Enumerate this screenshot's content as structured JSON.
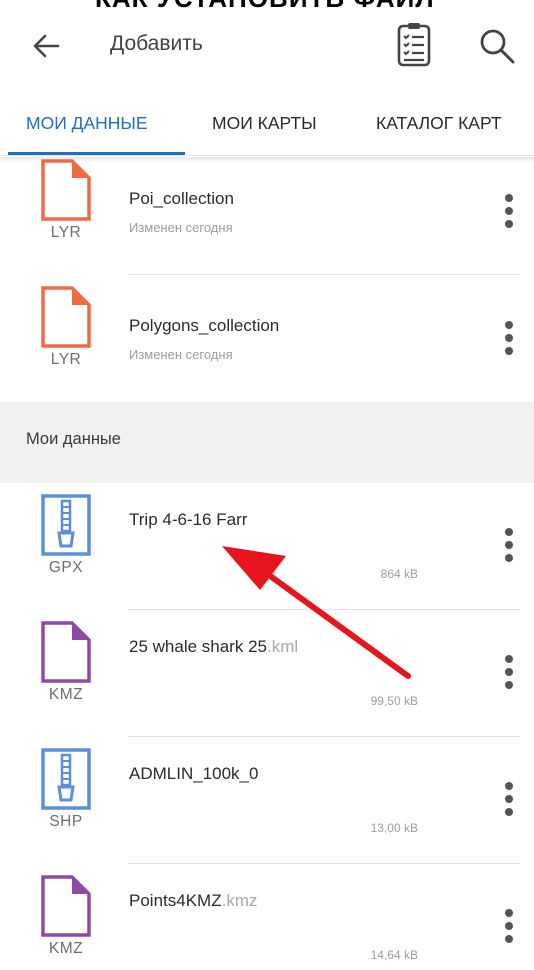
{
  "top_cut_text": "КАК УСТАНОВИТЬ ФАЙЛ",
  "appbar": {
    "title": "Добавить",
    "back_icon": "arrow-left-icon",
    "doc_icon": "checklist-document-icon",
    "search_icon": "search-icon"
  },
  "tabs": [
    {
      "label": "МОИ ДАННЫЕ",
      "active": true
    },
    {
      "label": "МОИ КАРТЫ",
      "active": false
    },
    {
      "label": "КАТАЛОГ КАРТ",
      "active": false
    }
  ],
  "layers": [
    {
      "name": "Poi_collection",
      "ext": "",
      "type": "LYR",
      "subtitle": "Изменен сегодня"
    },
    {
      "name": "Polygons_collection",
      "ext": "",
      "type": "LYR",
      "subtitle": "Изменен сегодня"
    }
  ],
  "section_title": "Мои данные",
  "files": [
    {
      "name": "Trip 4-6-16 Farr",
      "ext": "",
      "type": "GPX",
      "size": "864 kB"
    },
    {
      "name": "25 whale shark 25",
      "ext": ".kml",
      "type": "KMZ",
      "size": "99,50 kB"
    },
    {
      "name": "ADMLIN_100k_0",
      "ext": "",
      "type": "SHP",
      "size": "13,00 kB"
    },
    {
      "name": "Points4KMZ",
      "ext": ".kmz",
      "type": "KMZ",
      "size": "14,64 kB"
    }
  ],
  "colors": {
    "accent": "#1e6fc6",
    "lyr": "#ef6b43",
    "archive": "#5b8fd9",
    "kmz": "#8e4aa6",
    "annotation_arrow": "#e8141c"
  }
}
